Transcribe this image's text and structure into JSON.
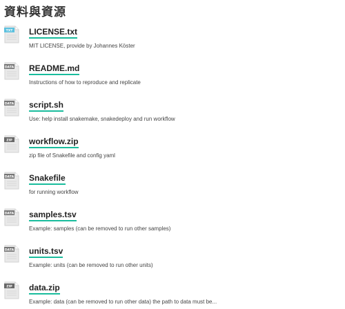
{
  "section": {
    "title": "資料與資源"
  },
  "resources": [
    {
      "name": "LICENSE.txt",
      "description": "MIT LICENSE, provide by Johannes Köster",
      "format_label": "TXT",
      "format_color": "#5bc0de",
      "icon": "txt-file-icon"
    },
    {
      "name": "README.md",
      "description": "Instructions of how to reproduce and replicate",
      "format_label": "DATA",
      "format_color": "#767676",
      "icon": "data-file-icon"
    },
    {
      "name": "script.sh",
      "description": "Use: help install snakemake, snakedeploy and run workflow",
      "format_label": "DATA",
      "format_color": "#767676",
      "icon": "data-file-icon"
    },
    {
      "name": "workflow.zip",
      "description": "zip file of Snakefile and config yaml",
      "format_label": "ZIP",
      "format_color": "#686868",
      "icon": "zip-file-icon"
    },
    {
      "name": "Snakefile",
      "description": "for running workflow",
      "format_label": "DATA",
      "format_color": "#767676",
      "icon": "data-file-icon"
    },
    {
      "name": "samples.tsv",
      "description": "Example: samples (can be removed to run other samples)",
      "format_label": "DATA",
      "format_color": "#767676",
      "icon": "data-file-icon"
    },
    {
      "name": "units.tsv",
      "description": "Example: units (can be removed to run other units)",
      "format_label": "DATA",
      "format_color": "#767676",
      "icon": "data-file-icon"
    },
    {
      "name": "data.zip",
      "description": "Example: data (can be removed to run other data) the path to data must be...",
      "format_label": "ZIP",
      "format_color": "#686868",
      "icon": "zip-file-icon"
    }
  ],
  "colors": {
    "link_underline": "#18bc9c",
    "title_text": "#333333",
    "icon_page": "#e9e9e9"
  }
}
